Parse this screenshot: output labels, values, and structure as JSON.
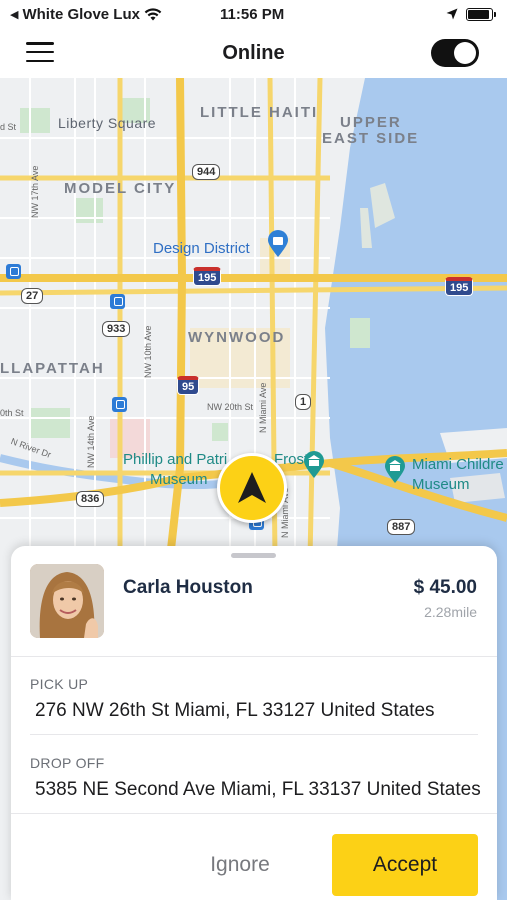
{
  "status_bar": {
    "carrier": "White Glove Lux",
    "time": "11:56 PM",
    "battery_level": 0.9
  },
  "nav": {
    "title": "Online",
    "online_toggle": true
  },
  "map": {
    "labels": {
      "liberty_square": "Liberty Square",
      "little_haiti": "LITTLE HAITI",
      "upper": "UPPER",
      "east_side": "EAST SIDE",
      "model_city": "MODEL CITY",
      "design_district": "Design District",
      "wynwood": "WYNWOOD",
      "allapattah": "LLAPATTAH",
      "phillip_1": "Phillip and Patri",
      "phillip_2": "Museum",
      "frost": "Frost",
      "miami_children_1": "Miami Childre",
      "miami_children_2": "Museum",
      "nw_17th": "NW 17th Ave",
      "nw_10th": "NW 10th Ave",
      "nw_14th": "NW 14th Ave",
      "nw_20th": "NW 20th St",
      "n_miami_ave": "N Miami Ave",
      "n_miami_ave2": "N Miami Ave",
      "nw_river": "N River Dr",
      "st_left": "d St",
      "st_left2": "0th St"
    },
    "shields": {
      "r944": "944",
      "r195a": "195",
      "r195b": "195",
      "r27": "27",
      "r933": "933",
      "r95": "95",
      "r1": "1",
      "r836": "836",
      "r887": "887"
    }
  },
  "ride_request": {
    "rider_name": "Carla Houston",
    "fare": "$ 45.00",
    "distance": "2.28mile",
    "pickup_label": "PICK UP",
    "pickup_address": "276 NW 26th St Miami, FL  33127 United States",
    "dropoff_label": "DROP OFF",
    "dropoff_address": "5385 NE Second Ave Miami, FL  33137 United States",
    "ignore_label": "Ignore",
    "accept_label": "Accept"
  },
  "colors": {
    "accent": "#fcd116",
    "water": "#a9c9ee",
    "road": "#f6d66c",
    "text_dark": "#1f2d44"
  }
}
